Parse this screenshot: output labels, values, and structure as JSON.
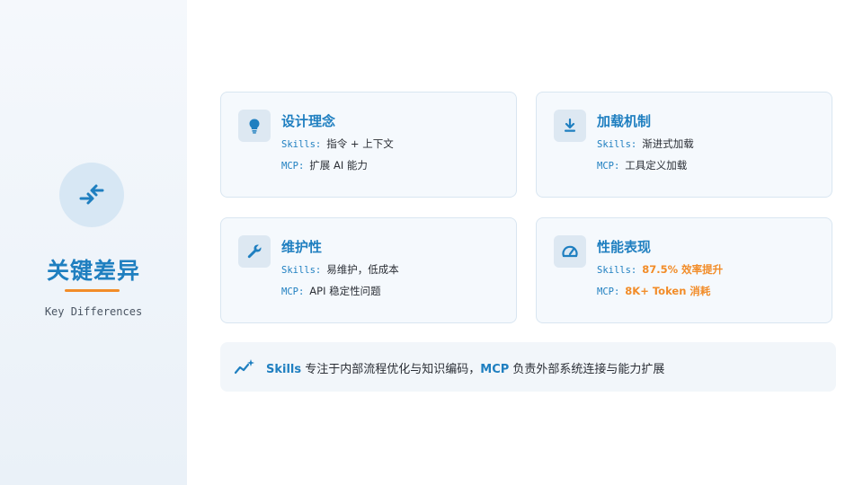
{
  "sidebar": {
    "title": "关键差异",
    "subtitle": "Key Differences",
    "icon": "compare-arrows-icon"
  },
  "cards": [
    {
      "icon": "lightbulb-icon",
      "title": "设计理念",
      "skills_key": "Skills:",
      "skills_value": "指令 + 上下文",
      "mcp_key": "MCP:",
      "mcp_value": "扩展 AI 能力"
    },
    {
      "icon": "download-icon",
      "title": "加载机制",
      "skills_key": "Skills:",
      "skills_value": "渐进式加载",
      "mcp_key": "MCP:",
      "mcp_value": "工具定义加载"
    },
    {
      "icon": "wrench-icon",
      "title": "维护性",
      "skills_key": "Skills:",
      "skills_value": "易维护，低成本",
      "mcp_key": "MCP:",
      "mcp_value": "API 稳定性问题"
    },
    {
      "icon": "gauge-icon",
      "title": "性能表现",
      "skills_key": "Skills:",
      "skills_value": "87.5% 效率提升",
      "mcp_key": "MCP:",
      "mcp_value": "8K+ Token 消耗"
    }
  ],
  "summary": {
    "icon": "sparkle-trend-icon",
    "part1_highlight": "Skills",
    "part1_text": " 专注于内部流程优化与知识编码，",
    "part2_highlight": "MCP",
    "part2_text": " 负责外部系统连接与能力扩展"
  },
  "colors": {
    "primary": "#1f7fc0",
    "accent": "#f28c28",
    "card_bg": "#f5f9fd",
    "sidebar_bg": "#eef4fa"
  }
}
